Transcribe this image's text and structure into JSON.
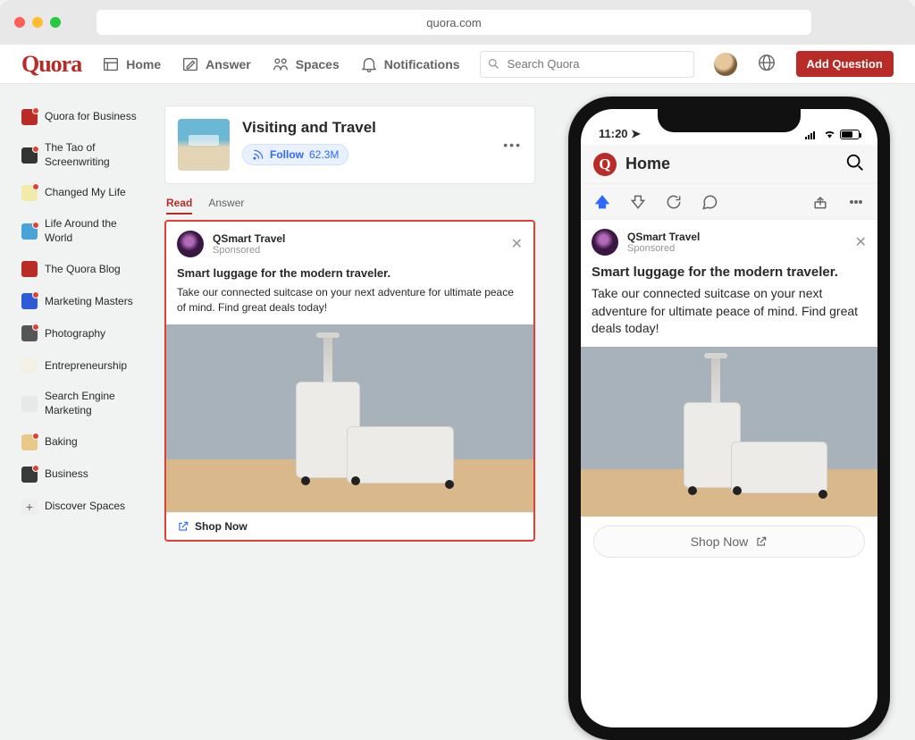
{
  "browser": {
    "url": "quora.com"
  },
  "nav": {
    "logo": "Quora",
    "home": "Home",
    "answer": "Answer",
    "spaces": "Spaces",
    "notifications": "Notifications",
    "search_placeholder": "Search Quora",
    "add_question": "Add Question"
  },
  "sidebar": {
    "items": [
      {
        "label": "Quora for Business"
      },
      {
        "label": "The Tao of Screenwriting"
      },
      {
        "label": "Changed My Life"
      },
      {
        "label": "Life Around the World"
      },
      {
        "label": "The Quora Blog"
      },
      {
        "label": "Marketing Masters"
      },
      {
        "label": "Photography"
      },
      {
        "label": "Entrepreneurship"
      },
      {
        "label": "Search Engine Marketing"
      },
      {
        "label": "Baking"
      },
      {
        "label": "Business"
      }
    ],
    "discover": "Discover Spaces"
  },
  "topic": {
    "title": "Visiting and Travel",
    "follow_label": "Follow",
    "follow_count": "62.3M"
  },
  "tabs": {
    "read": "Read",
    "answer": "Answer"
  },
  "ad": {
    "advertiser": "QSmart Travel",
    "sponsored": "Sponsored",
    "headline": "Smart luggage for the modern traveler.",
    "description": "Take our connected suitcase on your next adventure for ultimate peace of mind. Find great deals today!",
    "cta": "Shop Now"
  },
  "phone": {
    "time": "11:20",
    "header": "Home",
    "cta": "Shop Now"
  },
  "colors": {
    "brand": "#b92b27",
    "accent": "#2e69ff",
    "highlight": "#e23f32"
  }
}
